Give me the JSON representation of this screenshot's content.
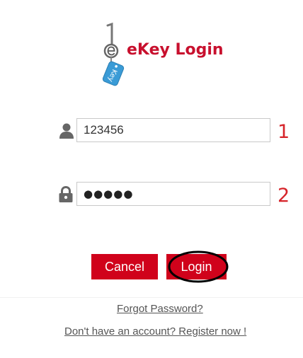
{
  "logo": {
    "title": "eKey Login",
    "tag_text": "Key",
    "brand_color": "#c8102e",
    "tag_color": "#3a9bd6"
  },
  "username": {
    "icon": "user-icon",
    "value": "123456",
    "step": "1"
  },
  "password": {
    "icon": "lock-icon",
    "value": "●●●●●",
    "step": "2"
  },
  "buttons": {
    "cancel_label": "Cancel",
    "login_label": "Login",
    "color": "#d0021b"
  },
  "links": {
    "forgot": "Forgot Password?",
    "register": "Don't have an account? Register now !"
  },
  "accent_number_color": "#d6242a"
}
